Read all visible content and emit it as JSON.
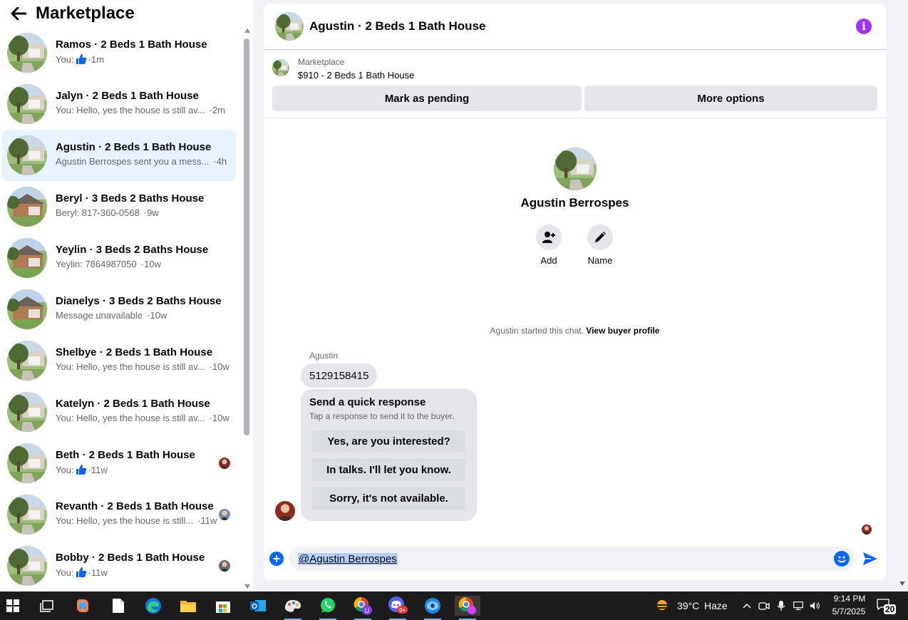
{
  "left_panel": {
    "title": "Marketplace",
    "conversations": [
      {
        "title": "Ramos · 2 Beds 1 Bath House",
        "prefix": "You:",
        "like": true,
        "text": "",
        "time": "·1m",
        "avatar": "house-tree",
        "mini": ""
      },
      {
        "title": "Jalyn · 2 Beds 1 Bath House",
        "prefix": "",
        "like": false,
        "text": "You: Hello, yes the house is still av...",
        "time": "·2m",
        "avatar": "house-tree",
        "mini": ""
      },
      {
        "title": "Agustin · 2 Beds 1 Bath House",
        "prefix": "",
        "like": false,
        "text": "Agustin Berrospes sent you a mess...",
        "time": "·4h",
        "avatar": "house-tree",
        "mini": ""
      },
      {
        "title": "Beryl · 3 Beds 2 Baths House",
        "prefix": "",
        "like": false,
        "text": "Beryl: 817-360-0568",
        "time": "·9w",
        "avatar": "house-brick",
        "mini": ""
      },
      {
        "title": "Yeylin · 3 Beds 2 Baths House",
        "prefix": "",
        "like": false,
        "text": "Yeylin: 7864987050",
        "time": "·10w",
        "avatar": "house-brick",
        "mini": ""
      },
      {
        "title": "Dianelys · 3 Beds 2 Baths House",
        "prefix": "",
        "like": false,
        "text": "Message unavailable",
        "time": "·10w",
        "avatar": "house-brick",
        "mini": ""
      },
      {
        "title": "Shelbye · 2 Beds 1 Bath House",
        "prefix": "",
        "like": false,
        "text": "You: Hello, yes the house is still av...",
        "time": "·10w",
        "avatar": "house-tree",
        "mini": ""
      },
      {
        "title": "Katelyn · 2 Beds 1 Bath House",
        "prefix": "",
        "like": false,
        "text": "You: Hello, yes the house is still av...",
        "time": "·10w",
        "avatar": "house-tree",
        "mini": ""
      },
      {
        "title": "Beth · 2 Beds 1 Bath House",
        "prefix": "You:",
        "like": true,
        "text": "",
        "time": "·11w",
        "avatar": "house-tree",
        "mini": "person-red"
      },
      {
        "title": "Revanth · 2 Beds 1 Bath House",
        "prefix": "",
        "like": false,
        "text": "You: Hello, yes the house is still...",
        "time": "·11w",
        "avatar": "house-tree",
        "mini": "person-blue"
      },
      {
        "title": "Bobby · 2 Beds 1 Bath House",
        "prefix": "You:",
        "like": true,
        "text": "",
        "time": "·11w",
        "avatar": "house-tree",
        "mini": "person-gray"
      }
    ],
    "active_index": 2
  },
  "chat": {
    "title": "Agustin · 2 Beds 1 Bath House",
    "listing_source": "Marketplace",
    "listing_name": "$910 - 2 Beds 1 Bath House",
    "mark_pending_label": "Mark as pending",
    "more_options_label": "More options",
    "profile_name": "Agustin Berrospes",
    "add_label": "Add",
    "name_label": "Name",
    "started_text": "Agustin started this chat.",
    "view_profile_label": "View buyer profile",
    "sender_name": "Agustin",
    "message_text": "5129158415",
    "quick_response_title": "Send a quick response",
    "quick_response_subtitle": "Tap a response to send it to the buyer.",
    "quick_responses": [
      "Yes, are you interested?",
      "In talks. I'll let you know.",
      "Sorry, it's not available."
    ],
    "input_value": "@Agustin Berrospes",
    "accent_color": "#0866ff",
    "info_color": "#a033ff"
  },
  "taskbar": {
    "weather_temp": "39°C",
    "weather_condition": "Haze",
    "time": "9:14 PM",
    "date": "5/7/2025",
    "notification_count": "20",
    "apps": [
      "start",
      "task-view",
      "copilot",
      "notepad",
      "edge",
      "file-explorer",
      "store",
      "outlook",
      "paint",
      "whatsapp",
      "chrome-profile-u",
      "discord",
      "app-blue",
      "chrome"
    ],
    "badges": {
      "chrome-profile-u": "U",
      "discord": "9+"
    }
  }
}
